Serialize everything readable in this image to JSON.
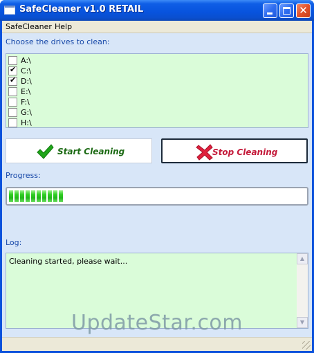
{
  "window": {
    "title": "SafeCleaner v1.0 RETAIL"
  },
  "menu": [
    "SafeCleaner",
    "Help"
  ],
  "drives": {
    "label": "Choose the drives to clean:",
    "items": [
      {
        "label": "A:\\",
        "checked": false
      },
      {
        "label": "C:\\",
        "checked": true
      },
      {
        "label": "D:\\",
        "checked": true
      },
      {
        "label": "E:\\",
        "checked": false
      },
      {
        "label": "F:\\",
        "checked": false
      },
      {
        "label": "G:\\",
        "checked": false
      },
      {
        "label": "H:\\",
        "checked": false
      }
    ]
  },
  "buttons": {
    "start_label": "Start Cleaning",
    "stop_label": "Stop Cleaning"
  },
  "progress": {
    "label": "Progress:",
    "fraction": 0.19,
    "fill_color": "#2fcf23"
  },
  "log": {
    "label": "Log:",
    "text": "Cleaning started, please wait..."
  },
  "watermark": "UpdateStar.com",
  "colors": {
    "title_bar": "#0753dd",
    "client_bg": "#d8e6f8",
    "list_bg": "#dafcd9",
    "label_blue": "#1748a8",
    "start_green": "#1c6a14",
    "stop_red": "#c41a3a"
  }
}
